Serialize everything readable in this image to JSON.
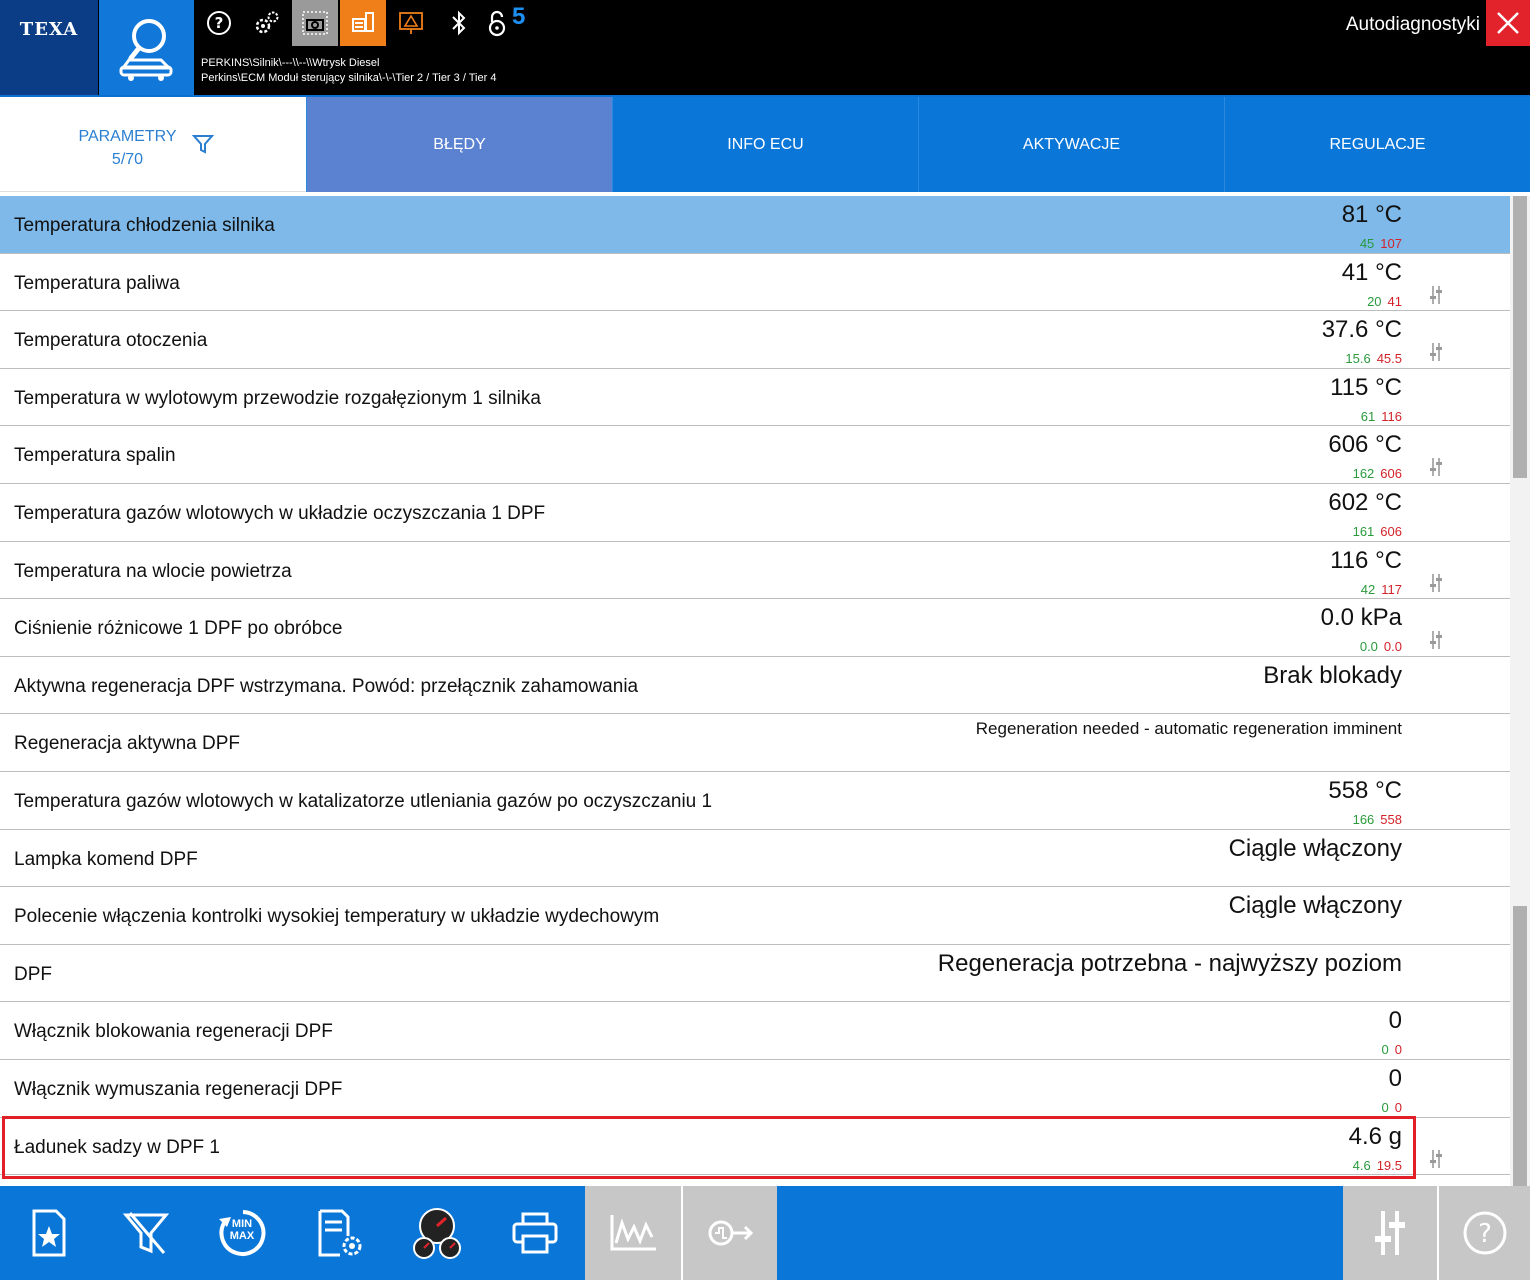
{
  "header": {
    "brand": "TEXA",
    "notification_count": "5",
    "path_line1": "PERKINS\\Silnik\\---\\\\--\\\\Wtrysk Diesel",
    "path_line2": "Perkins\\ECM Moduł sterujący silnika\\-\\-\\Tier 2 / Tier 3 / Tier 4",
    "app_title": "Autodiagnostyki",
    "icons": [
      "search-car-icon",
      "help-icon",
      "gears-icon",
      "screenshot-icon",
      "report-icon",
      "warning-icon",
      "bluetooth-icon",
      "lock-icon",
      "close-icon"
    ]
  },
  "tabs": {
    "params_label": "PARAMETRY",
    "params_count": "5/70",
    "items": [
      {
        "label": "BŁĘDY",
        "active": true
      },
      {
        "label": "INFO ECU",
        "active": false
      },
      {
        "label": "AKTYWACJE",
        "active": false
      },
      {
        "label": "REGULACJE",
        "active": false
      }
    ]
  },
  "rows": [
    {
      "name": "Temperatura chłodzenia silnika",
      "value": "81 °C",
      "min": "45",
      "max": "107",
      "selected": true,
      "adjust": false
    },
    {
      "name": "Temperatura paliwa",
      "value": "41 °C",
      "min": "20",
      "max": "41",
      "adjust": true
    },
    {
      "name": "Temperatura otoczenia",
      "value": "37.6 °C",
      "min": "15.6",
      "max": "45.5",
      "adjust": true
    },
    {
      "name": "Temperatura w wylotowym przewodzie rozgałęzionym 1 silnika",
      "value": "115 °C",
      "min": "61",
      "max": "116",
      "adjust": false
    },
    {
      "name": "Temperatura spalin",
      "value": "606 °C",
      "min": "162",
      "max": "606",
      "adjust": true
    },
    {
      "name": "Temperatura gazów wlotowych w układzie oczyszczania 1 DPF",
      "value": "602 °C",
      "min": "161",
      "max": "606",
      "adjust": false
    },
    {
      "name": "Temperatura na wlocie powietrza",
      "value": "116 °C",
      "min": "42",
      "max": "117",
      "adjust": true
    },
    {
      "name": "Ciśnienie różnicowe 1 DPF po obróbce",
      "value": "0.0 kPa",
      "min": "0.0",
      "max": "0.0",
      "adjust": true
    },
    {
      "name": "Aktywna regeneracja DPF wstrzymana. Powód: przełącznik zahamowania",
      "value": "Brak blokady",
      "adjust": false
    },
    {
      "name": "Regeneracja aktywna DPF",
      "value": "Regeneration needed - automatic regeneration imminent",
      "small": true,
      "adjust": false
    },
    {
      "name": "Temperatura gazów wlotowych w katalizatorze utleniania gazów po oczyszczaniu 1",
      "value": "558 °C",
      "min": "166",
      "max": "558",
      "adjust": false
    },
    {
      "name": "Lampka komend DPF",
      "value": "Ciągle włączony",
      "adjust": false
    },
    {
      "name": "Polecenie włączenia kontrolki wysokiej temperatury w układzie wydechowym",
      "value": "Ciągle włączony",
      "adjust": false
    },
    {
      "name": "DPF",
      "value": "Regeneracja potrzebna - najwyższy poziom",
      "adjust": false
    },
    {
      "name": "Włącznik blokowania regeneracji DPF",
      "value": "0",
      "min": "0",
      "max": "0",
      "adjust": false
    },
    {
      "name": "Włącznik wymuszania regeneracji DPF",
      "value": "0",
      "min": "0",
      "max": "0",
      "adjust": false
    },
    {
      "name": "Ładunek sadzy w DPF 1",
      "value": "4.6 g",
      "min": "4.6",
      "max": "19.5",
      "adjust": true
    }
  ],
  "bottombar": {
    "icons": [
      "favorite-doc-icon",
      "clear-filter-icon",
      "min-max-reset-icon",
      "settings-doc-icon",
      "gauges-icon",
      "print-icon",
      "graph-icon",
      "export-icon",
      "adjust-icon",
      "help-icon"
    ],
    "minmax_label": "MIN MAX"
  },
  "colors": {
    "accent": "#0a76d8",
    "active_tab": "#5a82d0",
    "selected_row": "#7eb9e9",
    "min_color": "#2a9a3c",
    "max_color": "#d2232a",
    "highlight": "#e01f26"
  }
}
